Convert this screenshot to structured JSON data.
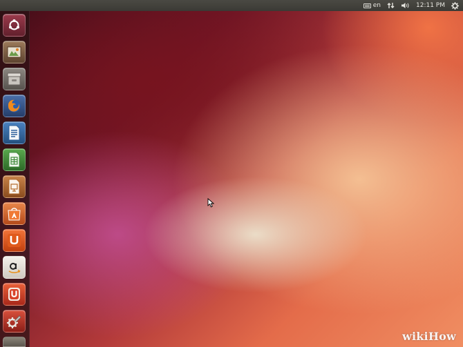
{
  "topbar": {
    "keyboard_layout": "en",
    "clock": "12:11 PM",
    "icons": [
      "keyboard-icon",
      "network-icon",
      "volume-icon",
      "session-gear-icon"
    ]
  },
  "launcher": {
    "items": [
      {
        "name": "Dash Home",
        "icon": "ubuntu-dash-icon",
        "color": "#7a2a3a"
      },
      {
        "name": "Workspace Switcher",
        "icon": "workspace-switcher-icon",
        "color": "#7b5a3e"
      },
      {
        "name": "Files",
        "icon": "files-icon",
        "color": "#6f6b66"
      },
      {
        "name": "Firefox Web Browser",
        "icon": "firefox-icon",
        "color": "#2f4f8a"
      },
      {
        "name": "LibreOffice Writer",
        "icon": "libreoffice-writer-icon",
        "color": "#2c5f9a"
      },
      {
        "name": "LibreOffice Calc",
        "icon": "libreoffice-calc-icon",
        "color": "#3f8a3a"
      },
      {
        "name": "LibreOffice Impress",
        "icon": "libreoffice-impress-icon",
        "color": "#b36a2a"
      },
      {
        "name": "Ubuntu Software Center",
        "icon": "software-center-icon",
        "color": "#d9662e"
      },
      {
        "name": "Ubuntu One",
        "icon": "ubuntu-one-icon",
        "color": "#e05a1c"
      },
      {
        "name": "Amazon",
        "icon": "amazon-icon",
        "color": "#e8e4dc"
      },
      {
        "name": "Ubuntu One Music",
        "icon": "ubuntu-one-music-icon",
        "color": "#d8432a"
      },
      {
        "name": "System Settings",
        "icon": "system-settings-icon",
        "color": "#b8332c"
      }
    ]
  },
  "watermark": "wikiHow"
}
